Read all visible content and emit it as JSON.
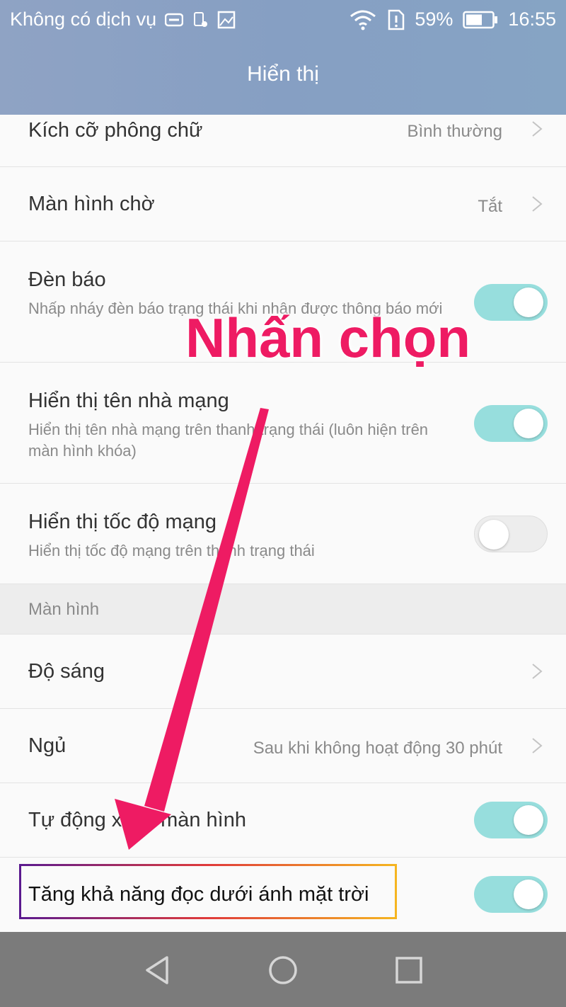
{
  "status": {
    "carrier": "Không có dịch vụ",
    "battery": "59%",
    "time": "16:55"
  },
  "header": {
    "title": "Hiển thị"
  },
  "rows": [
    {
      "label": "Kích cỡ phông chữ",
      "value": "Bình thường"
    },
    {
      "label": "Màn hình chờ",
      "value": "Tắt"
    },
    {
      "label": "Đèn báo",
      "sub": "Nhấp nháy đèn báo trạng thái khi nhận được thông báo mới",
      "toggle": true
    },
    {
      "label": "Hiển thị tên nhà mạng",
      "sub": "Hiển thị tên nhà mạng trên thanh trạng thái (luôn hiện trên màn hình khóa)",
      "toggle": true
    },
    {
      "label": "Hiển thị tốc độ mạng",
      "sub": "Hiển thị tốc độ mạng trên thanh trạng thái",
      "toggle": false
    }
  ],
  "section": {
    "label": "Màn hình"
  },
  "rows2": [
    {
      "label": "Độ sáng"
    },
    {
      "label": "Ngủ",
      "value": "Sau khi không hoạt động 30 phút"
    },
    {
      "label": "Tự động xoay màn hình",
      "toggle": true
    },
    {
      "label": "Tăng khả năng đọc dưới ánh mặt trời",
      "toggle": true
    }
  ],
  "annotation": {
    "text": "Nhấn chọn",
    "color": "#ee1b63"
  },
  "colors": {
    "header": "#869fc3",
    "toggle_on": "#97dedd"
  }
}
